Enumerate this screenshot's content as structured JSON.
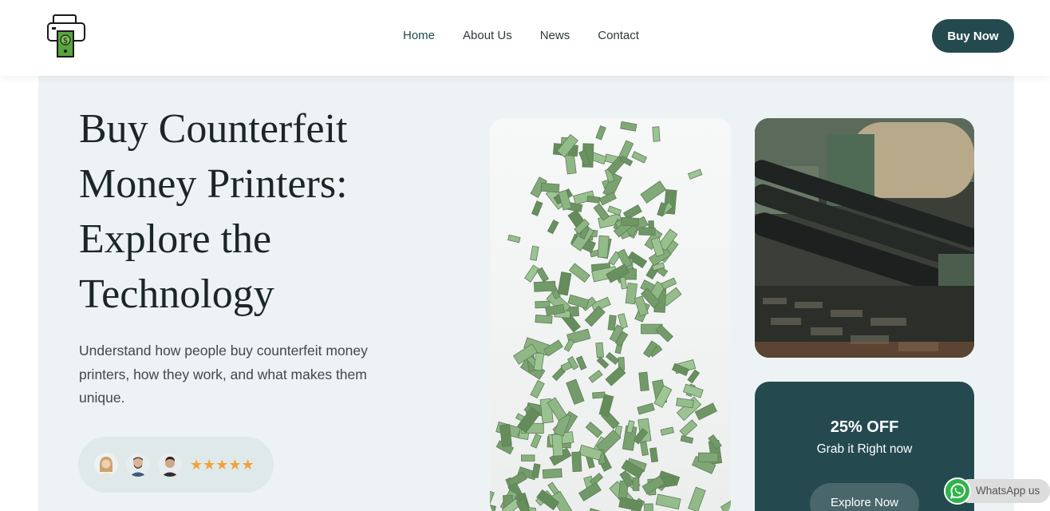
{
  "header": {
    "logo_icon": "money-printer-icon",
    "nav": [
      {
        "label": "Home"
      },
      {
        "label": "About Us"
      },
      {
        "label": "News"
      },
      {
        "label": "Contact"
      }
    ],
    "buy_label": "Buy Now"
  },
  "hero": {
    "title": "Buy Counterfeit Money Printers: Explore the Technology",
    "subtitle": "Understand how people buy counterfeit money printers, how they work, and what makes them unique.",
    "rating": {
      "stars": "★★★★★",
      "avatars": [
        "avatar-woman",
        "avatar-man-beard",
        "avatar-man"
      ]
    },
    "offer": {
      "title": "25% OFF",
      "subtitle": "Grab it Right now",
      "button_label": "Explore Now"
    }
  },
  "whatsapp": {
    "label": "WhatsApp us",
    "icon": "whatsapp-icon"
  },
  "colors": {
    "brand": "#244a4f",
    "hero_bg": "#edf2f4",
    "star": "#f0a23a"
  }
}
